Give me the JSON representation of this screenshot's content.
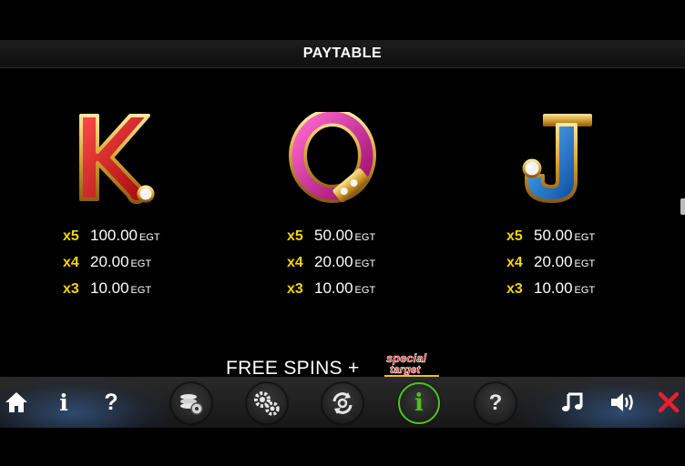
{
  "header": {
    "title": "PAYTABLE"
  },
  "paytable": [
    {
      "symbol": "K",
      "rows": [
        {
          "mult": "x5",
          "amount": "100.00",
          "currency": "EGT"
        },
        {
          "mult": "x4",
          "amount": "20.00",
          "currency": "EGT"
        },
        {
          "mult": "x3",
          "amount": "10.00",
          "currency": "EGT"
        }
      ]
    },
    {
      "symbol": "Q",
      "rows": [
        {
          "mult": "x5",
          "amount": "50.00",
          "currency": "EGT"
        },
        {
          "mult": "x4",
          "amount": "20.00",
          "currency": "EGT"
        },
        {
          "mult": "x3",
          "amount": "10.00",
          "currency": "EGT"
        }
      ]
    },
    {
      "symbol": "J",
      "rows": [
        {
          "mult": "x5",
          "amount": "50.00",
          "currency": "EGT"
        },
        {
          "mult": "x4",
          "amount": "20.00",
          "currency": "EGT"
        },
        {
          "mult": "x3",
          "amount": "10.00",
          "currency": "EGT"
        }
      ]
    }
  ],
  "free_spins": {
    "label": "FREE SPINS +",
    "logo_text_1": "special",
    "logo_text_2": "target"
  },
  "toolbar": {
    "left": {
      "home": {
        "icon": "home-icon"
      },
      "info": {
        "label": "i",
        "icon": "info-icon"
      },
      "help": {
        "label": "?",
        "icon": "help-icon"
      }
    },
    "center": [
      {
        "name": "bet-settings-button",
        "icon": "coins-gear-icon"
      },
      {
        "name": "settings-button",
        "icon": "gears-icon"
      },
      {
        "name": "autoplay-button",
        "icon": "refresh-gear-icon"
      },
      {
        "name": "paytable-info-button",
        "icon": "info-icon",
        "label": "i",
        "active": true
      },
      {
        "name": "help-button",
        "icon": "help-icon",
        "label": "?"
      }
    ],
    "right": {
      "music": {
        "icon": "music-note-icon"
      },
      "sound": {
        "icon": "speaker-icon"
      },
      "close": {
        "icon": "close-icon",
        "color": "#e8202a"
      }
    }
  },
  "colors": {
    "multiplier": "#f4d500",
    "active_ring": "#4cc31a",
    "k_symbol": "#e01a1a",
    "q_symbol": "#d81a9a",
    "j_symbol": "#1a7ad8",
    "gold": "#e8b640"
  }
}
